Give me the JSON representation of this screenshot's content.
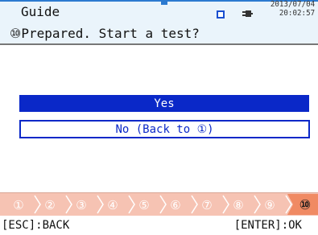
{
  "header": {
    "title": "Guide",
    "battery_icon": "battery-icon",
    "power_icon": "plug-icon",
    "date": "2013/07/04",
    "time": "20:02:57"
  },
  "prompt": {
    "text": "⑩Prepared. Start a test?"
  },
  "options": {
    "yes_label": "Yes",
    "no_label": "No (Back to ①)",
    "selected": "Yes"
  },
  "steps": {
    "labels": [
      "①",
      "②",
      "③",
      "④",
      "⑤",
      "⑥",
      "⑦",
      "⑧",
      "⑨",
      "⑩"
    ],
    "current": 10
  },
  "footer": {
    "esc_label": "[ESC]:BACK",
    "enter_label": "[ENTER]:OK"
  },
  "colors": {
    "header_bg": "#eaf4fb",
    "selected_bg": "#0a28c8",
    "step_bar_bg": "#f6c3b3",
    "step_active": "#f08a63",
    "step_inactive_text": "#ffffff"
  }
}
